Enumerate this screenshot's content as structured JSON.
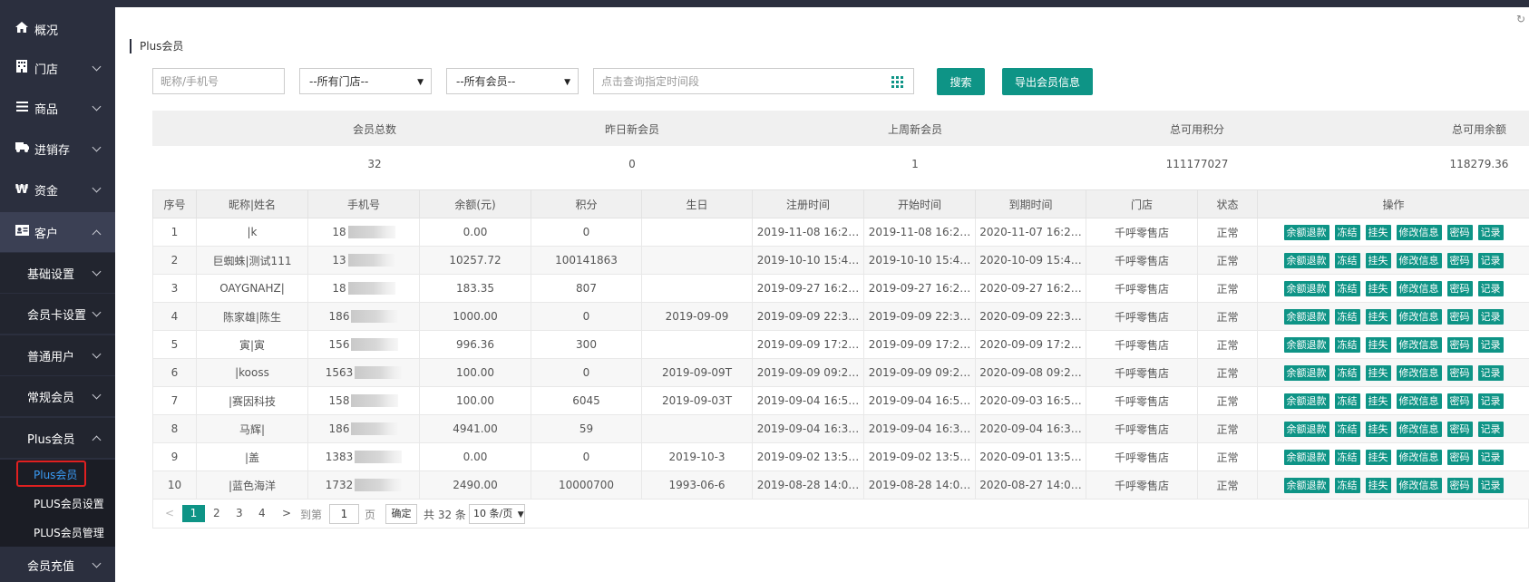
{
  "sidebar": {
    "items": [
      {
        "label": "概况",
        "icon": "home-icon"
      },
      {
        "label": "门店",
        "icon": "store-icon"
      },
      {
        "label": "商品",
        "icon": "list-icon"
      },
      {
        "label": "进销存",
        "icon": "truck-icon"
      },
      {
        "label": "资金",
        "icon": "won-icon"
      },
      {
        "label": "客户",
        "icon": "id-card-icon"
      }
    ],
    "sub_items": [
      {
        "label": "基础设置"
      },
      {
        "label": "会员卡设置"
      },
      {
        "label": "普通用户"
      },
      {
        "label": "常规会员"
      },
      {
        "label": "Plus会员"
      }
    ],
    "leaves": [
      {
        "label": "Plus会员"
      },
      {
        "label": "PLUS会员设置"
      },
      {
        "label": "PLUS会员管理"
      }
    ],
    "bottom_item": {
      "label": "会员充值"
    }
  },
  "page": {
    "title": "Plus会员"
  },
  "filters": {
    "name_placeholder": "昵称/手机号",
    "store_selected": "--所有门店--",
    "member_selected": "--所有会员--",
    "date_placeholder": "点击查询指定时间段",
    "search_label": "搜索",
    "export_label": "导出会员信息"
  },
  "stats": {
    "labels": [
      "会员总数",
      "昨日新会员",
      "上周新会员",
      "总可用积分",
      "总可用余额"
    ],
    "values": [
      "32",
      "0",
      "1",
      "111177027",
      "118279.36"
    ]
  },
  "table": {
    "headers": [
      "序号",
      "昵称|姓名",
      "手机号",
      "余额(元)",
      "积分",
      "生日",
      "注册时间",
      "开始时间",
      "到期时间",
      "门店",
      "状态",
      "操作"
    ],
    "actions": [
      "余额退款",
      "冻结",
      "挂失",
      "修改信息",
      "密码",
      "记录"
    ],
    "rows": [
      [
        "1",
        "|k",
        "18",
        "0.00",
        "0",
        "",
        "2019-11-08 16:2…",
        "2019-11-08 16:2…",
        "2020-11-07 16:2…",
        "千呼零售店",
        "正常"
      ],
      [
        "2",
        "巨蜘蛛|测试111",
        "13",
        "10257.72",
        "100141863",
        "",
        "2019-10-10 15:4…",
        "2019-10-10 15:4…",
        "2020-10-09 15:4…",
        "千呼零售店",
        "正常"
      ],
      [
        "3",
        "OAYGNAHZ|",
        "18",
        "183.35",
        "807",
        "",
        "2019-09-27 16:2…",
        "2019-09-27 16:2…",
        "2020-09-27 16:2…",
        "千呼零售店",
        "正常"
      ],
      [
        "4",
        "陈家雄|陈生",
        "186",
        "1000.00",
        "0",
        "2019-09-09",
        "2019-09-09 22:3…",
        "2019-09-09 22:3…",
        "2020-09-09 22:3…",
        "千呼零售店",
        "正常"
      ],
      [
        "5",
        "寅|寅",
        "156",
        "996.36",
        "300",
        "",
        "2019-09-09 17:2…",
        "2019-09-09 17:2…",
        "2020-09-09 17:2…",
        "千呼零售店",
        "正常"
      ],
      [
        "6",
        "|kooss",
        "1563",
        "100.00",
        "0",
        "2019-09-09T",
        "2019-09-09 09:2…",
        "2019-09-09 09:2…",
        "2020-09-08 09:2…",
        "千呼零售店",
        "正常"
      ],
      [
        "7",
        "|赛因科技",
        "158",
        "100.00",
        "6045",
        "2019-09-03T",
        "2019-09-04 16:5…",
        "2019-09-04 16:5…",
        "2020-09-03 16:5…",
        "千呼零售店",
        "正常"
      ],
      [
        "8",
        "马辉|",
        "186",
        "4941.00",
        "59",
        "",
        "2019-09-04 16:3…",
        "2019-09-04 16:3…",
        "2020-09-04 16:3…",
        "千呼零售店",
        "正常"
      ],
      [
        "9",
        "|盖",
        "1383",
        "0.00",
        "0",
        "2019-10-3",
        "2019-09-02 13:5…",
        "2019-09-02 13:5…",
        "2020-09-01 13:5…",
        "千呼零售店",
        "正常"
      ],
      [
        "10",
        "|蓝色海洋",
        "1732",
        "2490.00",
        "10000700",
        "1993-06-6",
        "2019-08-28 14:0…",
        "2019-08-28 14:0…",
        "2020-08-27 14:0…",
        "千呼零售店",
        "正常"
      ]
    ]
  },
  "pagination": {
    "prev": "<",
    "pages": [
      "1",
      "2",
      "3",
      "4"
    ],
    "next": ">",
    "goto_label": "到第",
    "goto_value": "1",
    "page_unit": "页",
    "confirm": "确定",
    "total": "共 32 条",
    "page_size": "10 条/页"
  },
  "colors": {
    "sidebar_bg": "#2b2f3e",
    "accent": "#0e9486",
    "active_link": "#3a9bf5",
    "highlight_border": "#e02020"
  }
}
